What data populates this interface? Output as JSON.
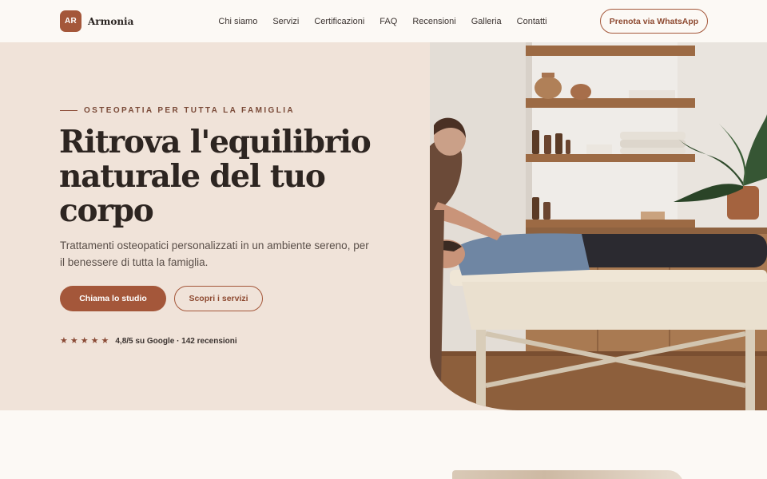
{
  "brand": {
    "initials": "AR",
    "name": "Armonia"
  },
  "nav": {
    "items": [
      "Chi siamo",
      "Servizi",
      "Certificazioni",
      "FAQ",
      "Recensioni",
      "Galleria",
      "Contatti"
    ]
  },
  "header": {
    "cta_label": "Prenota via WhatsApp"
  },
  "hero": {
    "eyebrow": "OSTEOPATIA PER TUTTA LA FAMIGLIA",
    "title_line1": "Ritrova l'equilibrio",
    "title_line2": "naturale del tuo",
    "title_line3": "corpo",
    "subtitle": "Trattamenti osteopatici personalizzati in un ambiente sereno, per il benessere di tutta la famiglia.",
    "primary_cta": "Chiama lo studio",
    "secondary_cta": "Scopri i servizi",
    "rating_text": "4,8/5 su Google · 142 recensioni",
    "stars": 5,
    "image_alt": "osteopathic-treatment-photo"
  },
  "colors": {
    "accent": "#a4573a",
    "hero_bg": "#f0e3d9",
    "page_bg": "#fcf9f5",
    "text_dark": "#2d2521"
  }
}
